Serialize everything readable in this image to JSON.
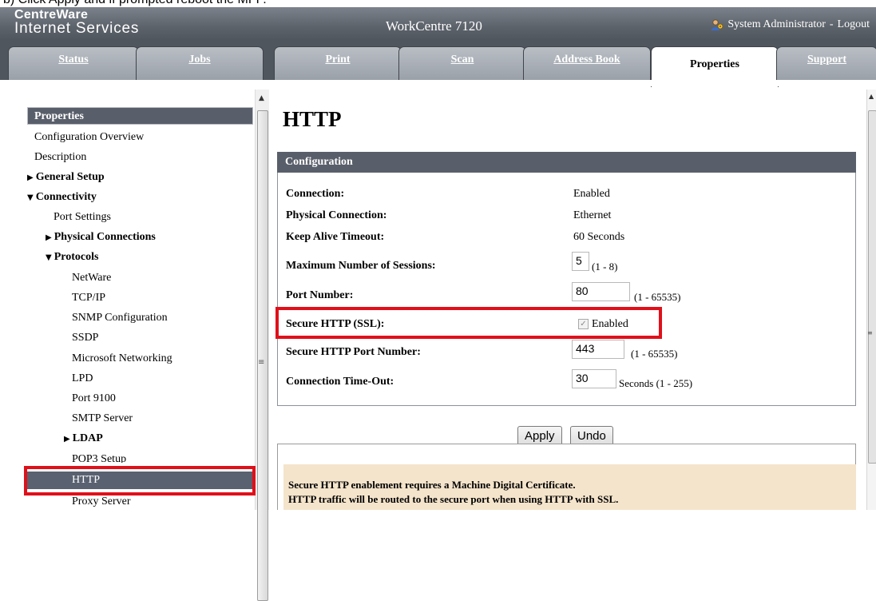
{
  "doc_caption": "b)  Click Apply and if prompted reboot the MFP.",
  "header": {
    "logo_line1": "CentreWare",
    "logo_line2": "Internet Services",
    "device": "WorkCentre 7120",
    "user": "System Administrator",
    "separator": " - ",
    "logout": "Logout"
  },
  "tabs": [
    {
      "label": "Status"
    },
    {
      "label": "Jobs"
    },
    {
      "label": "Print"
    },
    {
      "label": "Scan"
    },
    {
      "label": "Address Book"
    },
    {
      "label": "Properties"
    },
    {
      "label": "Support"
    }
  ],
  "sidebar": {
    "title": "Properties",
    "items": [
      {
        "label": "Configuration Overview"
      },
      {
        "label": "Description"
      },
      {
        "label": "General Setup"
      },
      {
        "label": "Connectivity"
      },
      {
        "label": "Port Settings"
      },
      {
        "label": "Physical Connections"
      },
      {
        "label": "Protocols"
      },
      {
        "label": "NetWare"
      },
      {
        "label": "TCP/IP"
      },
      {
        "label": "SNMP Configuration"
      },
      {
        "label": "SSDP"
      },
      {
        "label": "Microsoft Networking"
      },
      {
        "label": "LPD"
      },
      {
        "label": "Port 9100"
      },
      {
        "label": "SMTP Server"
      },
      {
        "label": "LDAP"
      },
      {
        "label": "POP3 Setup"
      },
      {
        "label": "HTTP"
      },
      {
        "label": "Proxy Server"
      }
    ],
    "selected": "HTTP"
  },
  "main": {
    "title": "HTTP",
    "section": "Configuration",
    "rows": {
      "connection": {
        "label": "Connection:",
        "value": "Enabled"
      },
      "physical": {
        "label": "Physical Connection:",
        "value": "Ethernet"
      },
      "keepalive": {
        "label": "Keep Alive Timeout:",
        "value": "60 Seconds"
      },
      "max_sessions": {
        "label": "Maximum Number of Sessions:",
        "value": "5",
        "range": "(1 - 8)"
      },
      "port": {
        "label": "Port Number:",
        "value": "80",
        "range": "(1 - 65535)"
      },
      "ssl": {
        "label": "Secure HTTP (SSL):",
        "checked": true,
        "checkbox_label": "Enabled"
      },
      "ssl_port": {
        "label": "Secure HTTP Port Number:",
        "value": "443",
        "range": "(1 - 65535)"
      },
      "timeout": {
        "label": "Connection Time-Out:",
        "value": "30",
        "range": "Seconds (1 - 255)"
      }
    },
    "buttons": {
      "apply": "Apply",
      "undo": "Undo"
    },
    "note": {
      "line1": "Secure HTTP enablement requires a Machine Digital Certificate.",
      "line2": "HTTP traffic will be routed to the secure port when using HTTP with SSL."
    }
  },
  "colors": {
    "header_bg": "#5d636b",
    "section_bar": "#595f6a",
    "highlight_box": "#e0101a",
    "note_bg": "#f4e4cb"
  },
  "icons": {
    "user": "admin-user-icon"
  }
}
